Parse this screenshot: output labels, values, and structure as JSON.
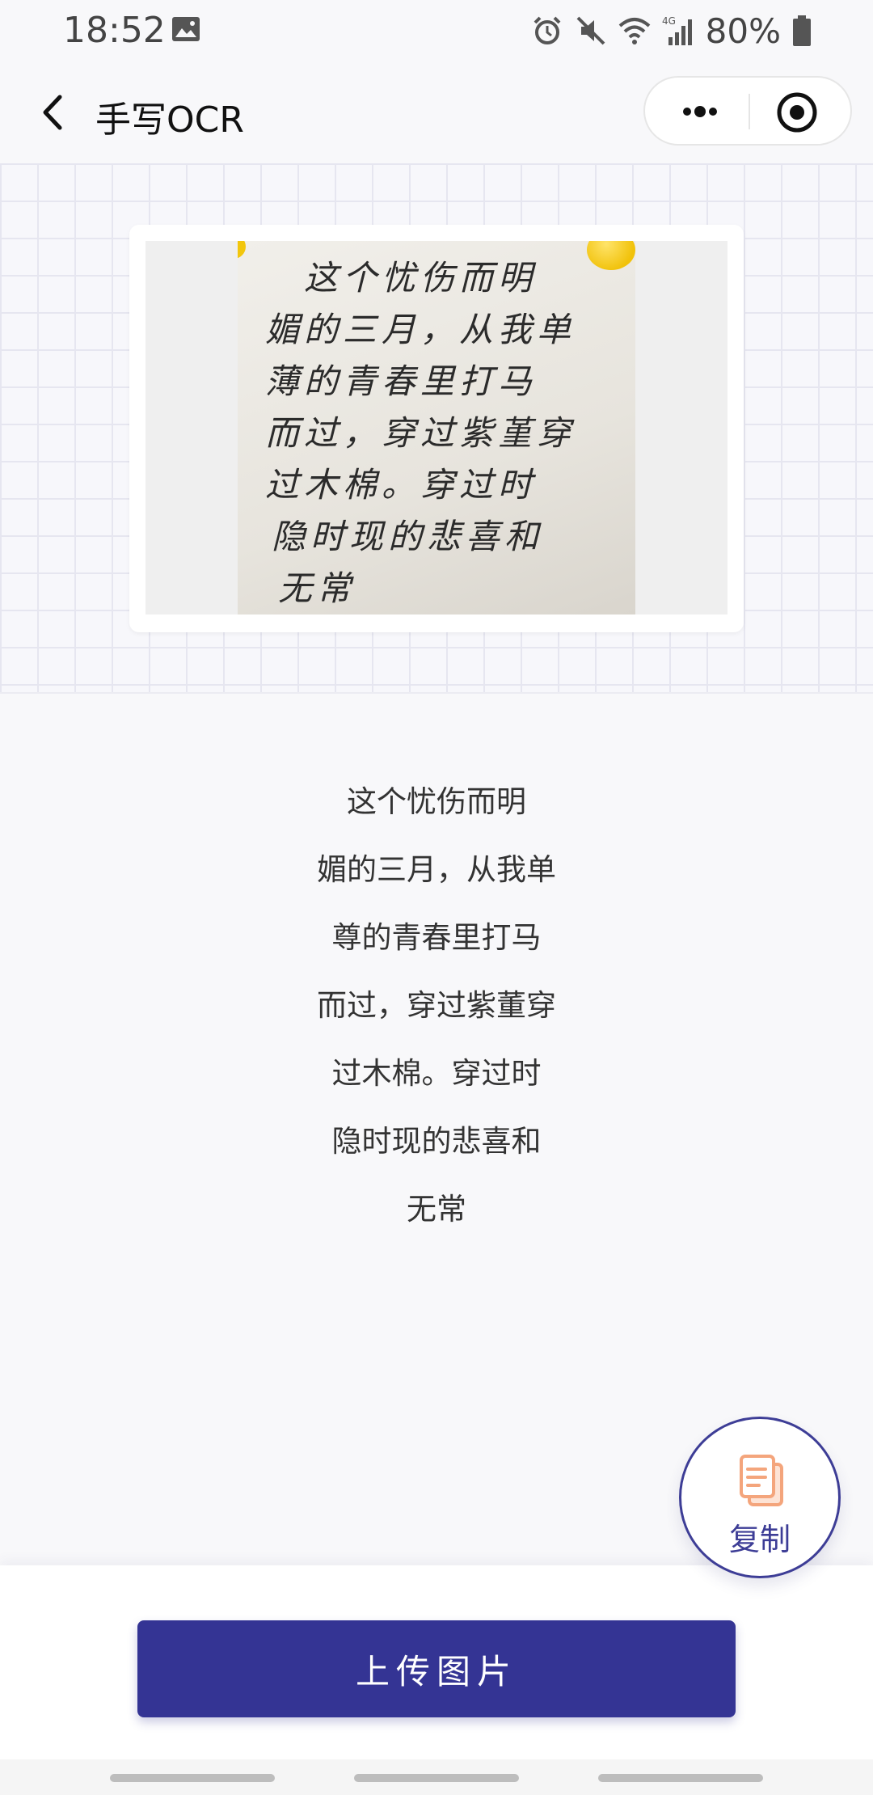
{
  "status_bar": {
    "time": "18:52",
    "battery": "80%",
    "icons": [
      "gallery-icon",
      "alarm-icon",
      "mute-icon",
      "wifi-icon",
      "4g-signal-icon",
      "battery-icon"
    ]
  },
  "nav": {
    "title": "手写OCR",
    "back_icon": "chevron-left-icon",
    "more_icon": "more-dots-icon",
    "close_icon": "mini-program-close-icon"
  },
  "photo": {
    "handwriting_lines": [
      "这个忧伤而明",
      "媚的三月，从我单",
      "薄的青春里打马",
      "而过，穿过紫堇穿",
      "过木棉。穿过时",
      "隐时现的悲喜和",
      "无常"
    ]
  },
  "result": {
    "lines": [
      "这个忧伤而明",
      "媚的三月，从我单",
      "尊的青春里打马",
      "而过，穿过紫董穿",
      "过木棉。穿过时",
      "隐时现的悲喜和",
      "无常"
    ]
  },
  "copy_button": {
    "label": "复制",
    "icon": "copy-document-icon",
    "icon_color": "#f4a57c"
  },
  "upload_button": {
    "label": "上传图片",
    "color": "#343494"
  }
}
